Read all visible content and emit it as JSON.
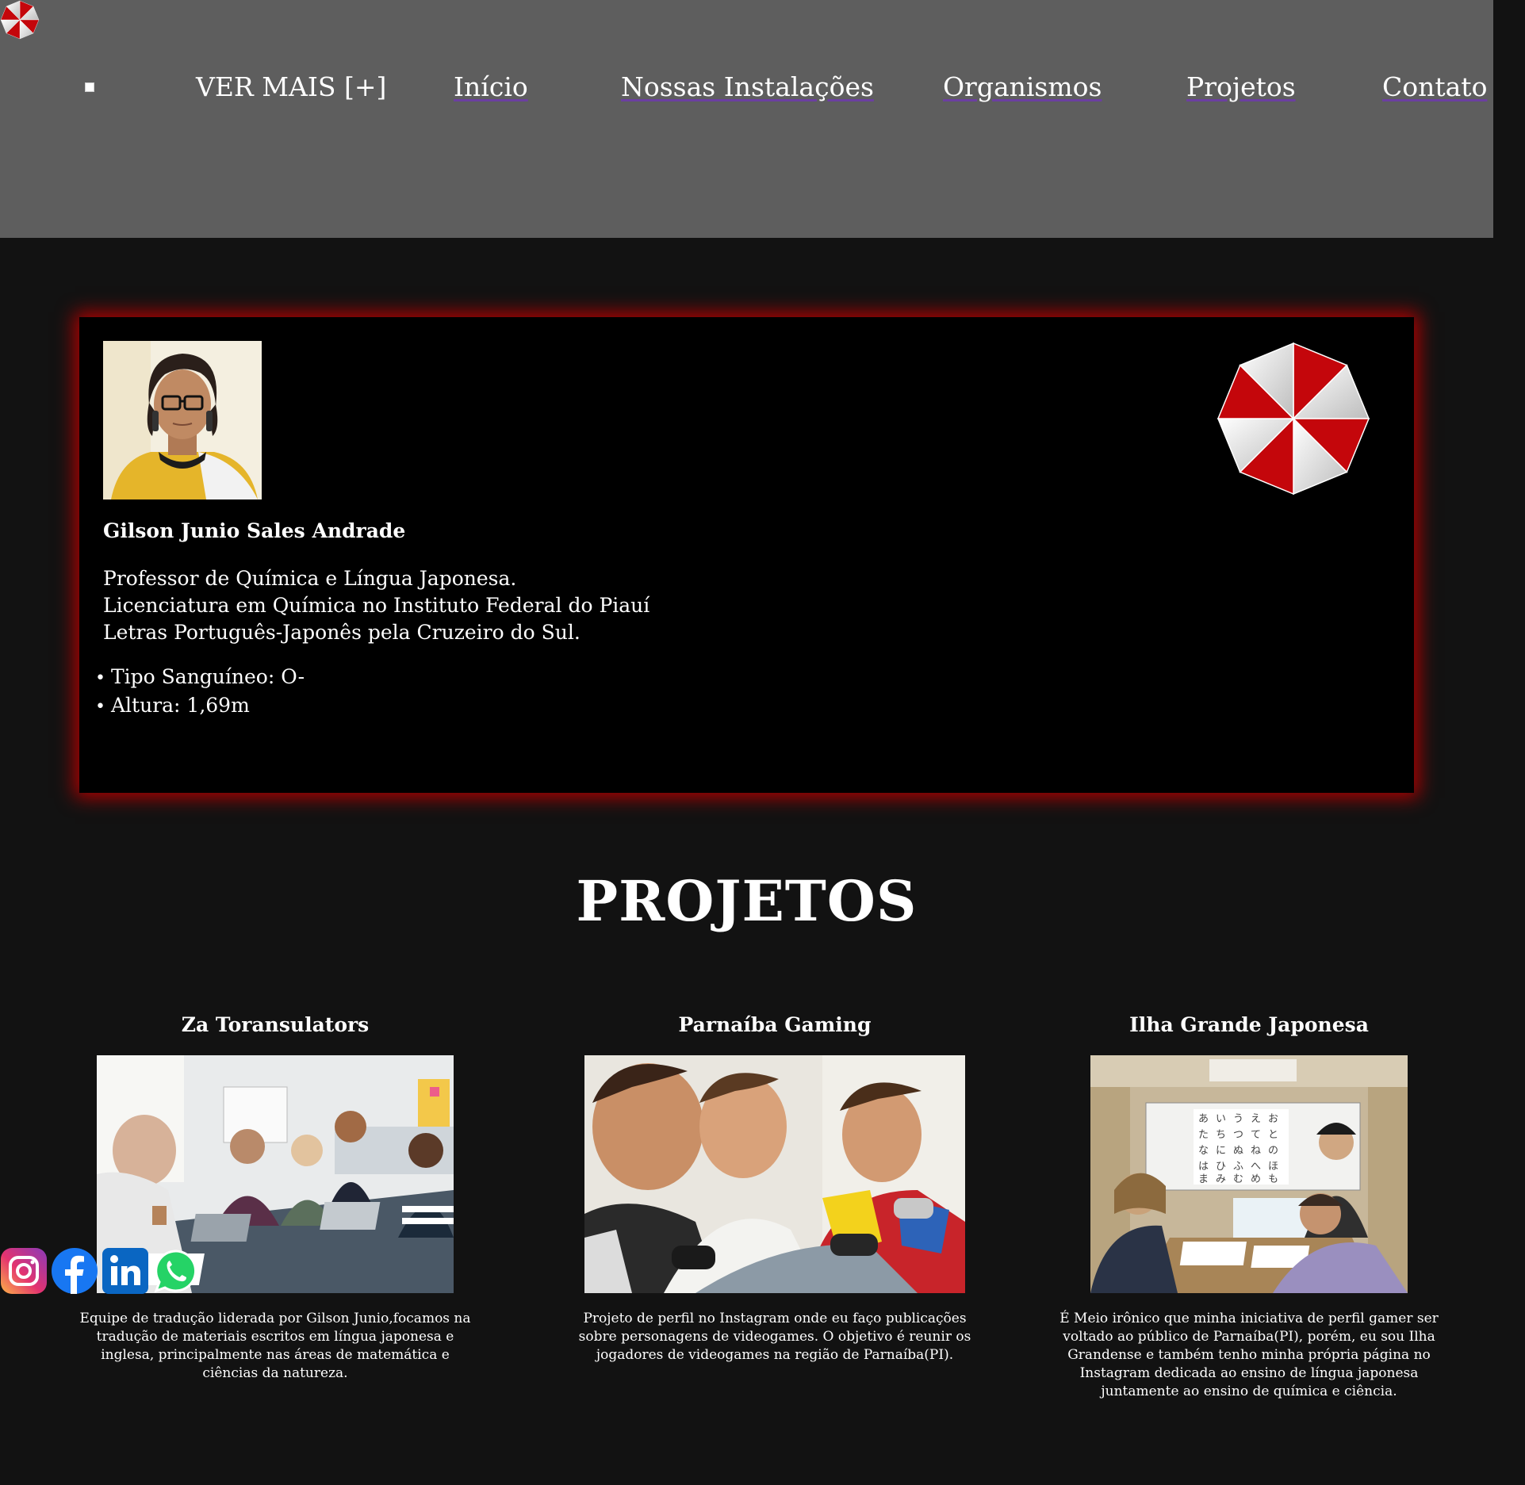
{
  "colors": {
    "nav_bg": "#5e5e5e",
    "page_bg": "#121212",
    "card_bg": "#000000",
    "card_glow": "#b00000",
    "umbrella_red": "#c4060b",
    "link_underline": "#6b3fa0"
  },
  "nav": {
    "logo_icon": "umbrella-corp-logo-icon",
    "items": [
      {
        "label": "VER MAIS [+]"
      },
      {
        "label": "Início"
      },
      {
        "label": "Nossas Instalações"
      },
      {
        "label": "Organismos"
      },
      {
        "label": "Projetos"
      },
      {
        "label": "Contato"
      }
    ]
  },
  "profile": {
    "name": "Gilson Junio Sales Andrade",
    "bio": [
      "Professor de Química e Língua Japonesa.",
      "Licenciatura em Química no Instituto Federal do Piauí",
      "Letras Português-Japonês pela Cruzeiro do Sul."
    ],
    "facts": [
      "Tipo Sanguíneo: O-",
      "Altura: 1,69m"
    ]
  },
  "projects": {
    "heading": "PROJETOS",
    "items": [
      {
        "title": "Za Toransulators",
        "desc": [
          "Equipe de tradução liderada por Gilson Junio,focamos na",
          "tradução de materiais escritos em língua japonesa e",
          "inglesa, principalmente nas áreas de matemática e",
          "ciências da natureza."
        ]
      },
      {
        "title": "Parnaíba Gaming",
        "desc": [
          "Projeto de perfil no Instagram onde eu faço publicações",
          "sobre personagens de videogames. O objetivo é reunir os",
          "jogadores de videogames na região de Parnaíba(PI)."
        ]
      },
      {
        "title": "Ilha Grande Japonesa",
        "desc": [
          "É Meio irônico que minha iniciativa de perfil gamer ser",
          "voltado ao público de Parnaíba(PI), porém, eu sou Ilha",
          "Grandense e também tenho minha própria página no",
          "Instagram dedicada ao ensino de língua japonesa",
          "juntamente ao ensino de química e ciência."
        ]
      }
    ]
  },
  "social": {
    "icons": [
      "instagram-icon",
      "facebook-icon",
      "linkedin-icon",
      "whatsapp-icon"
    ]
  }
}
